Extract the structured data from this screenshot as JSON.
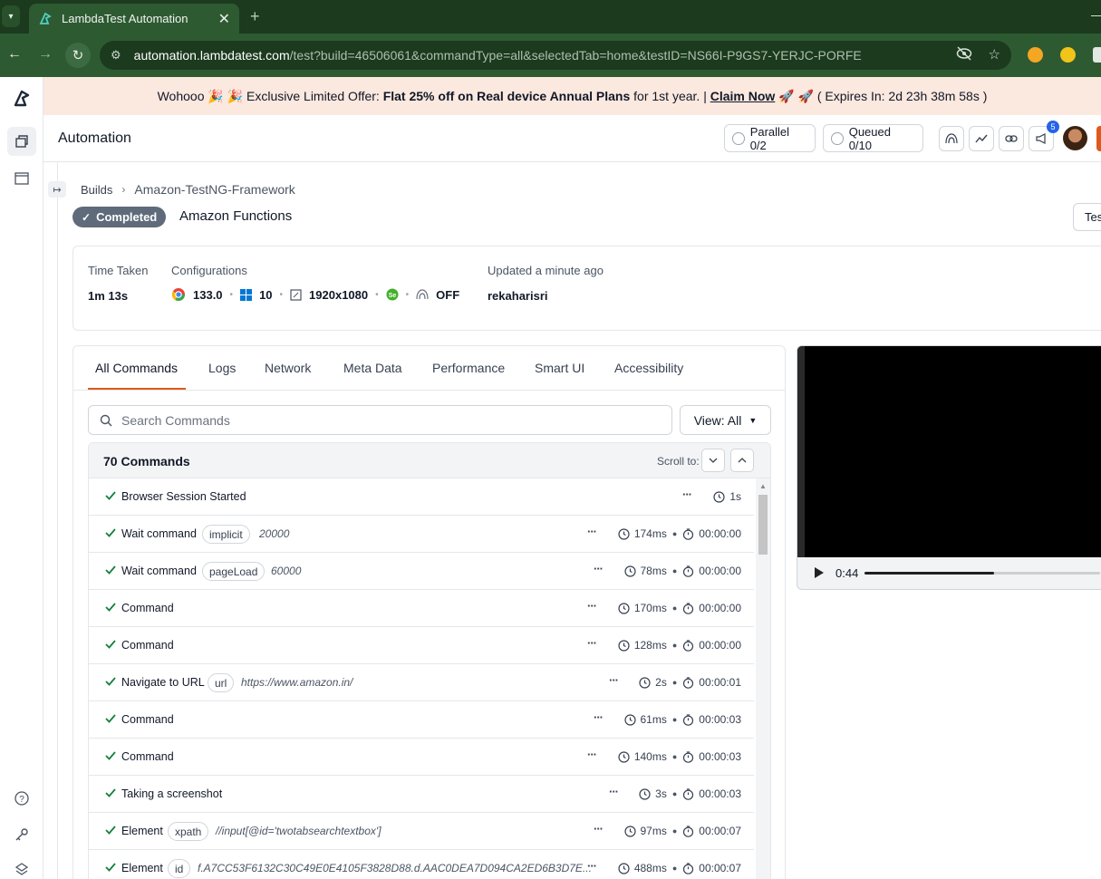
{
  "browser": {
    "tab_title": "LambdaTest Automation",
    "url_host": "automation.lambdatest.com",
    "url_path": "/test?build=46506061&commandType=all&selectedTab=home&testID=NS66I-P9GS7-YERJC-PORFE"
  },
  "banner": {
    "text_before": "Wohooo 🎉 🎉 Exclusive Limited Offer: ",
    "offer": "Flat 25% off on Real device Annual Plans",
    "text_after": " for 1st year. | ",
    "cta": "Claim Now",
    "rockets": " 🚀 🚀 ",
    "expiry": "( Expires In: 2d 23h 38m 58s )"
  },
  "header": {
    "title": "Automation",
    "parallel": "Parallel 0/2",
    "queued": "Queued 0/10",
    "notification_count": "5"
  },
  "breadcrumb": {
    "root": "Builds",
    "current": "Amazon-TestNG-Framework"
  },
  "test": {
    "status": "Completed",
    "name": "Amazon Functions",
    "tests_button": "Tests"
  },
  "info": {
    "time_taken_label": "Time Taken",
    "time_taken": "1m 13s",
    "configurations_label": "Configurations",
    "browser_version": "133.0",
    "os_version": "10",
    "resolution": "1920x1080",
    "tunnel": "OFF",
    "updated_label": "Updated a minute ago",
    "user": "rekaharisri"
  },
  "tabs": [
    "All Commands",
    "Logs",
    "Network",
    "Meta Data",
    "Performance",
    "Smart UI",
    "Accessibility"
  ],
  "search": {
    "placeholder": "Search Commands"
  },
  "view_button": "View: All",
  "list": {
    "count": "70 Commands",
    "scroll_to": "Scroll to:"
  },
  "commands": [
    {
      "name": "Browser Session Started",
      "tag": "",
      "arg": "",
      "duration": "1s",
      "at": ""
    },
    {
      "name": "Wait command",
      "tag": "implicit",
      "arg": "20000",
      "duration": "174ms",
      "at": "00:00:00"
    },
    {
      "name": "Wait command",
      "tag": "pageLoad",
      "arg": "60000",
      "duration": "78ms",
      "at": "00:00:00"
    },
    {
      "name": "Command",
      "tag": "",
      "arg": "",
      "duration": "170ms",
      "at": "00:00:00"
    },
    {
      "name": "Command",
      "tag": "",
      "arg": "",
      "duration": "128ms",
      "at": "00:00:00"
    },
    {
      "name": "Navigate to URL",
      "tag": "url",
      "arg": "https://www.amazon.in/",
      "duration": "2s",
      "at": "00:00:01"
    },
    {
      "name": "Command",
      "tag": "",
      "arg": "",
      "duration": "61ms",
      "at": "00:00:03"
    },
    {
      "name": "Command",
      "tag": "",
      "arg": "",
      "duration": "140ms",
      "at": "00:00:03"
    },
    {
      "name": "Taking a screenshot",
      "tag": "",
      "arg": "",
      "duration": "3s",
      "at": "00:00:03"
    },
    {
      "name": "Element",
      "tag": "xpath",
      "arg": "//input[@id='twotabsearchtextbox']",
      "duration": "97ms",
      "at": "00:00:07"
    },
    {
      "name": "Element",
      "tag": "id",
      "arg": "f.A7CC53F6132C30C49E0E4105F3828D88.d.AAC0DEA7D094CA2ED6B3D7E...",
      "duration": "488ms",
      "at": "00:00:07"
    }
  ],
  "video": {
    "time": "0:44",
    "progress": 0.55
  },
  "colors": {
    "accent": "#e0591c",
    "success": "#15803d",
    "badge": "#5f6b7a"
  }
}
